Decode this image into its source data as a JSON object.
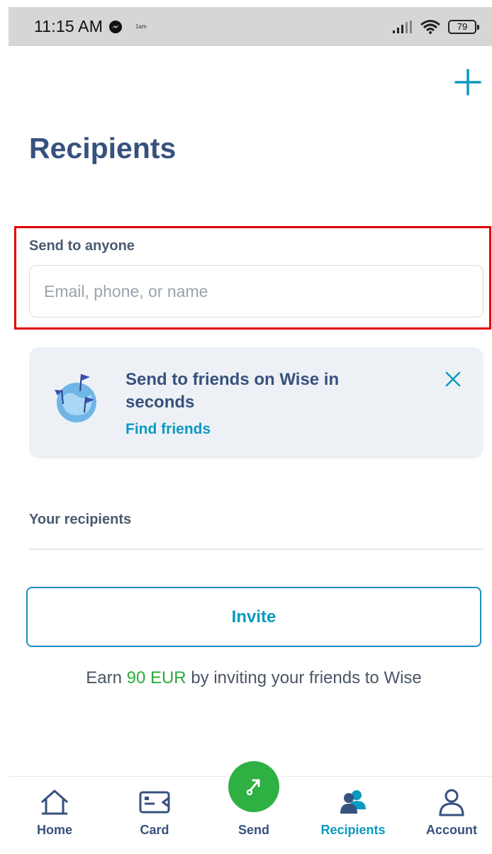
{
  "status_bar": {
    "time": "11:15 AM",
    "small_text": "1am",
    "battery": "79"
  },
  "header": {
    "title": "Recipients"
  },
  "search": {
    "label": "Send to anyone",
    "placeholder": "Email, phone, or name",
    "value": ""
  },
  "promo": {
    "title": "Send to friends on Wise in seconds",
    "link": "Find friends"
  },
  "recipients_section": {
    "label": "Your recipients"
  },
  "invite": {
    "button_label": "Invite",
    "earn_prefix": "Earn",
    "earn_amount": "90 EUR",
    "earn_suffix": "by inviting your friends to Wise"
  },
  "nav": {
    "items": [
      {
        "label": "Home",
        "icon": "home-icon"
      },
      {
        "label": "Card",
        "icon": "card-icon"
      },
      {
        "label": "Send",
        "icon": "send-icon"
      },
      {
        "label": "Recipients",
        "icon": "recipients-icon",
        "active": true
      },
      {
        "label": "Account",
        "icon": "account-icon"
      }
    ]
  },
  "colors": {
    "primary_text": "#37517e",
    "accent": "#0a9ac0",
    "send_green": "#2eb043",
    "earn_green": "#2eaa3c",
    "highlight_border": "#e00000"
  }
}
